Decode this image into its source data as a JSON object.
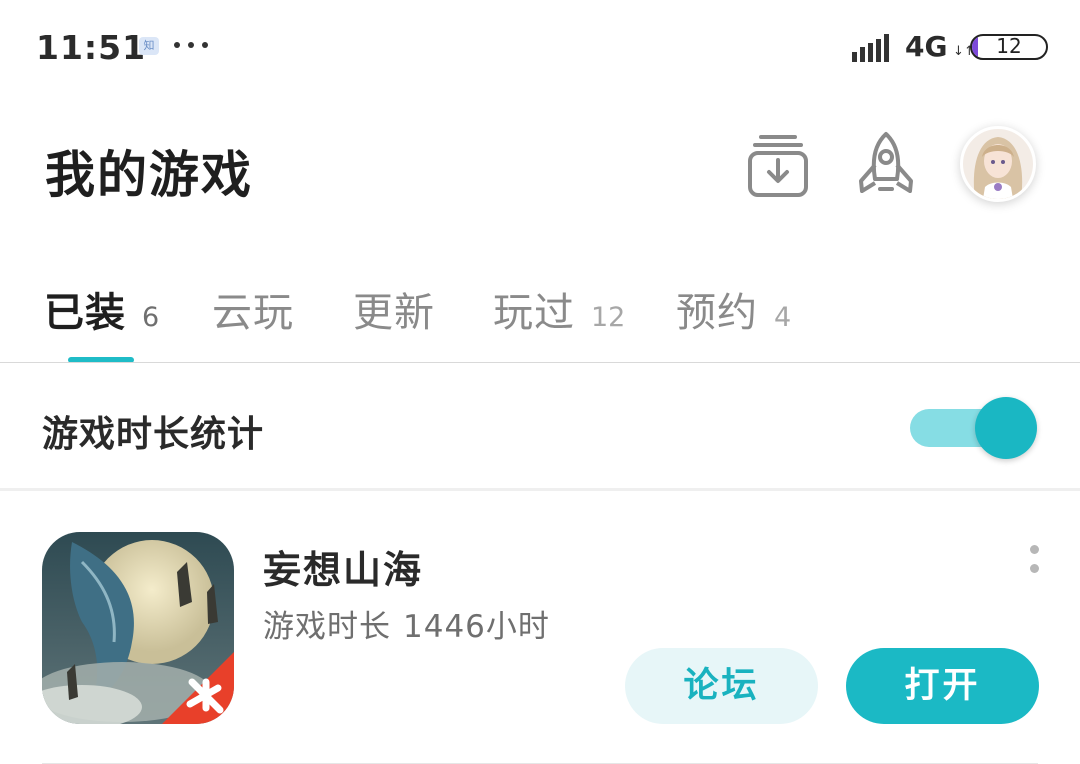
{
  "status_bar": {
    "time": "11:51",
    "app_icon_glyph": "知",
    "network": "4G",
    "network_arrows": "↓↑",
    "battery_level": "12",
    "battery_color": "#7d4ad9"
  },
  "header": {
    "title": "我的游戏",
    "icons": [
      "download-icon",
      "rocket-icon",
      "avatar"
    ]
  },
  "tabs": [
    {
      "label": "已装",
      "count": "6",
      "active": true
    },
    {
      "label": "云玩",
      "count": ""
    },
    {
      "label": "更新",
      "count": ""
    },
    {
      "label": "玩过",
      "count": "12"
    },
    {
      "label": "预约",
      "count": "4"
    }
  ],
  "stats": {
    "label": "游戏时长统计",
    "toggle_on": true
  },
  "games": [
    {
      "name": "妄想山海",
      "playtime_label": "游戏时长",
      "playtime_value": "1446小时",
      "forum_label": "论坛",
      "open_label": "打开"
    }
  ],
  "colors": {
    "accent": "#1bb9c5",
    "accent_light": "#e7f6f8"
  }
}
